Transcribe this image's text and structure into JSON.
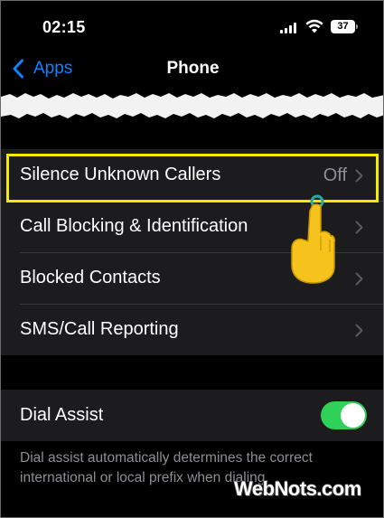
{
  "status_bar": {
    "time": "02:15",
    "battery": "37",
    "icons": [
      "cellular-signal-icon",
      "wifi-icon",
      "battery-icon"
    ]
  },
  "nav": {
    "back_label": "Apps",
    "title": "Phone"
  },
  "settings_group": [
    {
      "label": "Silence Unknown Callers",
      "value": "Off"
    },
    {
      "label": "Call Blocking & Identification",
      "value": ""
    },
    {
      "label": "Blocked Contacts",
      "value": ""
    },
    {
      "label": "SMS/Call Reporting",
      "value": ""
    }
  ],
  "dial_assist": {
    "label": "Dial Assist",
    "enabled": true,
    "footnote": "Dial assist automatically determines the correct international or local prefix when dialing."
  },
  "watermark": "WebNots.com",
  "colors": {
    "accent": "#0a84ff",
    "toggle_on": "#30d158",
    "highlight": "#f5ea00",
    "row_bg": "#1c1c1e",
    "secondary_text": "#8e8e93"
  }
}
